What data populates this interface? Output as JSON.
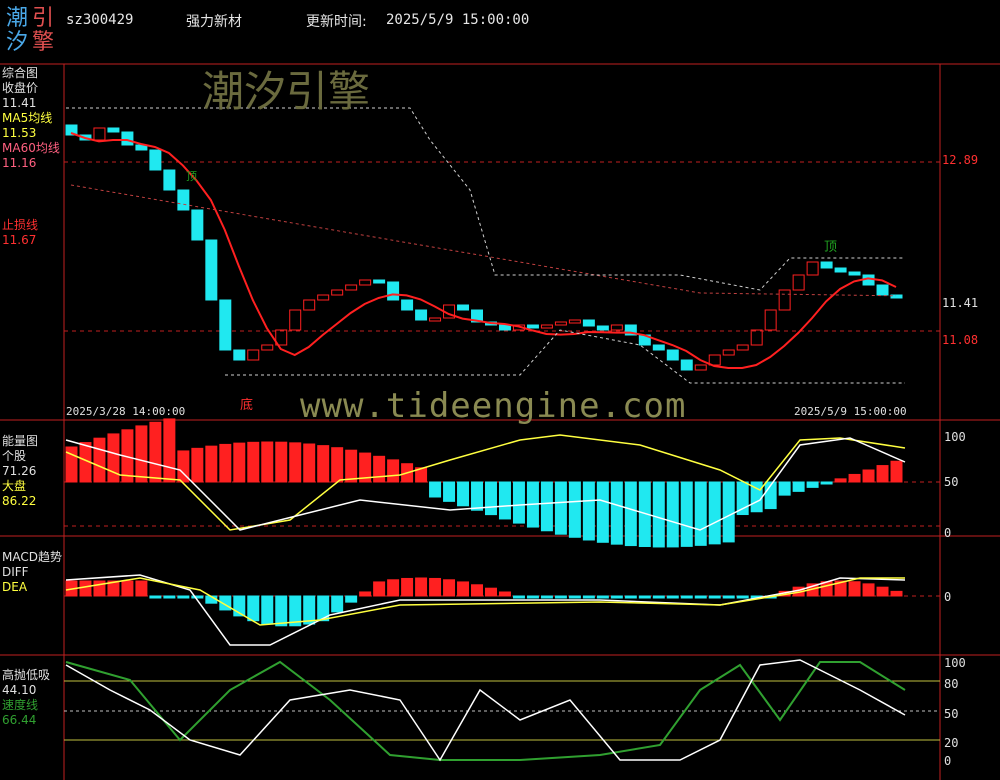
{
  "header": {
    "logo_chars": [
      "潮",
      "引",
      "汐",
      "擎"
    ],
    "code": "sz300429",
    "name": "强力新材",
    "update_label": "更新时间:",
    "update_time": "2025/5/9 15:00:00"
  },
  "watermark": {
    "brand": "潮汐引擎",
    "url": "www.tideengine.com"
  },
  "price_panel": {
    "title": "综合图",
    "close_label": "收盘价",
    "close_value": "11.41",
    "ma5_label": "MA5均线",
    "ma5_value": "11.53",
    "ma60_label": "MA60均线",
    "ma60_value": "11.16",
    "stop_label": "止损线",
    "stop_value": "11.67",
    "axis_ticks": [
      "12.89",
      "11.41",
      "11.08"
    ],
    "date_start": "2025/3/28 14:00:00",
    "date_end": "2025/5/9 15:00:00",
    "marker_top": "顶",
    "marker_bottom": "底",
    "marker_small": "顶"
  },
  "energy_panel": {
    "title": "能量图",
    "stock_label": "个股",
    "stock_value": "71.26",
    "market_label": "大盘",
    "market_value": "86.22",
    "axis_ticks": [
      "100",
      "50",
      "0"
    ]
  },
  "macd_panel": {
    "title": "MACD趋势",
    "diff_label": "DIFF",
    "dea_label": "DEA",
    "axis_ticks": [
      "0"
    ]
  },
  "hl_panel": {
    "title": "高抛低吸",
    "value1": "44.10",
    "speed_label": "速度线",
    "speed_value": "66.44",
    "axis_ticks": [
      "100",
      "80",
      "50",
      "20",
      "0"
    ]
  },
  "colors": {
    "up": "#ff2020",
    "down": "#20e8f0",
    "grid": "#c02020",
    "ma5": "#ffff40",
    "ma60": "#ff6080",
    "white": "#ffffff",
    "green": "#208020"
  }
}
